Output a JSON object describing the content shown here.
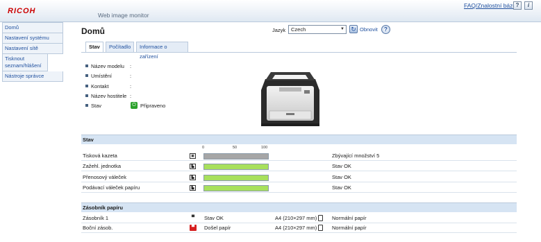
{
  "header": {
    "logo": "RICOH",
    "product": "Web image monitor",
    "faq_link": "FAQ/Znalostní báze",
    "help_icon": "?",
    "info_icon": "i"
  },
  "sidebar": {
    "items": [
      {
        "label": "Domů"
      },
      {
        "label": "Nastavení systému"
      },
      {
        "label": "Nastavení sítě"
      },
      {
        "label": "Tisknout seznam/hlášení"
      },
      {
        "label": "Nástroje správce"
      }
    ]
  },
  "main": {
    "title": "Domů",
    "language_label": "Jazyk",
    "language_value": "Czech",
    "refresh_label": "Obnovit",
    "help_icon": "?",
    "tabs": [
      {
        "label": "Stav",
        "active": true
      },
      {
        "label": "Počítadlo",
        "active": false
      },
      {
        "label": "Informace o zařízení",
        "active": false
      }
    ],
    "info": [
      {
        "label": "Název modelu",
        "value": ":"
      },
      {
        "label": "Umístění",
        "value": ":"
      },
      {
        "label": "Kontakt",
        "value": ":"
      },
      {
        "label": "Název hostitele",
        "value": ":"
      },
      {
        "label": "Stav",
        "value": "Připraveno"
      }
    ]
  },
  "status_section": {
    "title": "Stav",
    "scale": [
      "0",
      "50",
      "100"
    ],
    "rows": [
      {
        "label": "Tisková kazeta",
        "level_percent": 100,
        "bar_color": "#a6a6a6",
        "status": "Zbývající množství 5"
      },
      {
        "label": "Zažehl. jednotka",
        "level_percent": 100,
        "bar_color": "#a8e05c",
        "status": "Stav OK"
      },
      {
        "label": "Přenosový váleček",
        "level_percent": 100,
        "bar_color": "#a8e05c",
        "status": "Stav OK"
      },
      {
        "label": "Podávací váleček papíru",
        "level_percent": 100,
        "bar_color": "#a8e05c",
        "status": "Stav OK"
      }
    ]
  },
  "tray_section": {
    "title": "Zásobník papíru",
    "rows": [
      {
        "label": "Zásobník 1",
        "status": "Stav OK",
        "size": "A4 (210×297 mm)",
        "type": "Normální papír",
        "icon_color": "#333333"
      },
      {
        "label": "Boční zásob.",
        "status": "Došel papír",
        "size": "A4 (210×297 mm)",
        "type": "Normální papír",
        "icon_color": "#d62020"
      }
    ]
  }
}
